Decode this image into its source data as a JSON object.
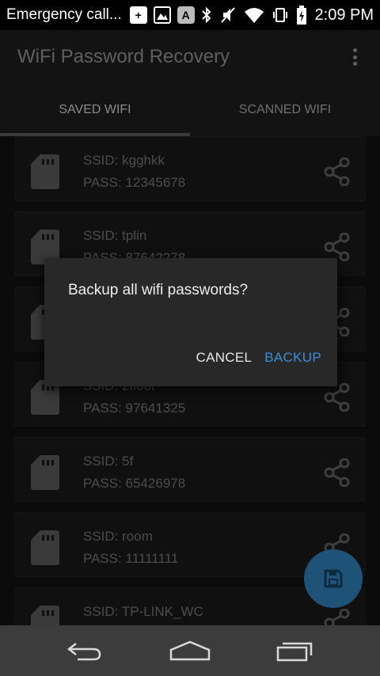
{
  "status_bar": {
    "left_text": "Emergency call...",
    "notifications": [
      {
        "icon": "plus-icon",
        "glyph": "+"
      },
      {
        "icon": "image-icon",
        "glyph": "▣"
      },
      {
        "icon": "a-badge-icon",
        "glyph": "A"
      }
    ],
    "system_icons": [
      "bluetooth-icon",
      "mute-icon",
      "wifi-icon",
      "vibrate-icon",
      "battery-icon"
    ],
    "time": "2:09 PM"
  },
  "app_bar": {
    "title": "WiFi Password Recovery",
    "menu_icon": "more-vert-icon"
  },
  "tabs": [
    {
      "label": "SAVED WIFI",
      "active": true
    },
    {
      "label": "SCANNED WIFI",
      "active": false
    }
  ],
  "networks": [
    {
      "ssid": "SSID:  kgghkk",
      "pass": "PASS:  12345678"
    },
    {
      "ssid": "SSID:  tplin",
      "pass": "PASS:  87642278"
    },
    {
      "ssid": "",
      "pass": ""
    },
    {
      "ssid": "SSID:  2floor",
      "pass": "PASS:  97641325"
    },
    {
      "ssid": "SSID:  5f",
      "pass": "PASS:  65426978"
    },
    {
      "ssid": "SSID:  room",
      "pass": "PASS:  11111111"
    },
    {
      "ssid": "SSID:  TP-LINK_WC",
      "pass": ""
    }
  ],
  "dialog": {
    "message": "Backup all wifi passwords?",
    "cancel_label": "CANCEL",
    "confirm_label": "BACKUP"
  },
  "fab": {
    "icon": "save-icon"
  },
  "nav_bar": {
    "buttons": [
      "back-icon",
      "home-icon",
      "recents-icon"
    ]
  },
  "colors": {
    "accent": "#3b8fd6",
    "dialog_bg": "#282828",
    "fab_bg": "#1f5277",
    "nav_bg": "#3c3c3c"
  }
}
